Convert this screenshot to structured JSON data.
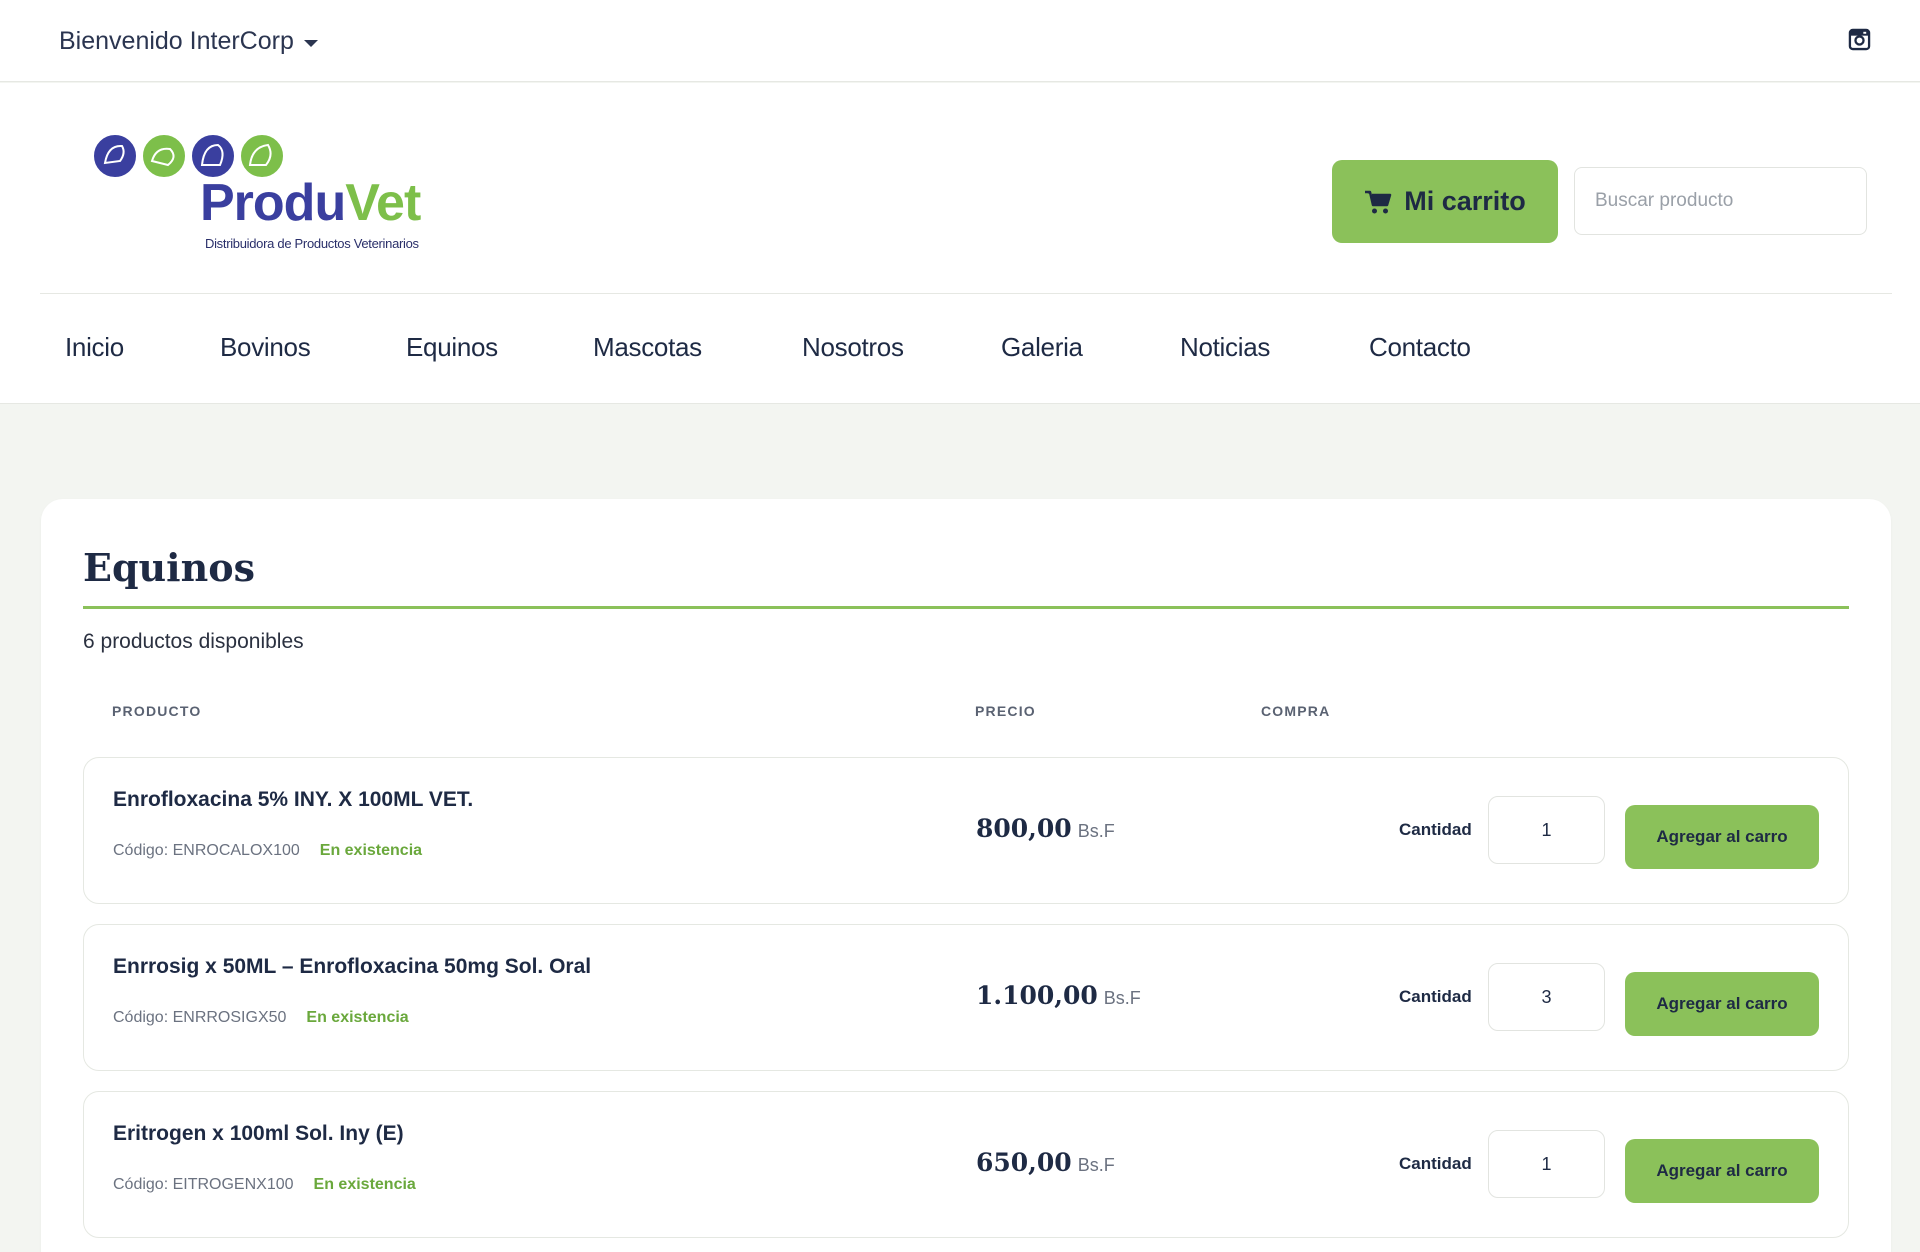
{
  "topbar": {
    "welcome": "Bienvenido InterCorp"
  },
  "header": {
    "logo_main_1": "Produ",
    "logo_main_2": "Vet",
    "logo_sub": "Distribuidora de Productos Veterinarios",
    "cart_label": "Mi carrito",
    "search_placeholder": "Buscar producto"
  },
  "nav": {
    "items": [
      {
        "label": "Inicio"
      },
      {
        "label": "Bovinos"
      },
      {
        "label": "Equinos"
      },
      {
        "label": "Mascotas"
      },
      {
        "label": "Nosotros"
      },
      {
        "label": "Galeria"
      },
      {
        "label": "Noticias"
      },
      {
        "label": "Contacto"
      }
    ]
  },
  "colors": {
    "accent_green": "#8bc15a",
    "navy": "#1e2a44",
    "stock_green": "#6aa83c"
  },
  "main": {
    "title": "Equinos",
    "count": "6 productos disponibles",
    "columns": {
      "product": "PRODUCTO",
      "price": "PRECIO",
      "purchase": "COMPRA"
    },
    "products": [
      {
        "name": "Enrofloxacina 5% INY. X 100ML VET.",
        "code": "Código: ENROCALOX100",
        "stock": "En existencia",
        "price": "800,00",
        "currency": "Bs.F",
        "qty_label": "Cantidad",
        "qty": "1",
        "add_label": "Agregar al carro"
      },
      {
        "name": "Enrrosig x 50ML – Enrofloxacina 50mg Sol. Oral",
        "code": "Código: ENRROSIGX50",
        "stock": "En existencia",
        "price": "1.100,00",
        "currency": "Bs.F",
        "qty_label": "Cantidad",
        "qty": "3",
        "add_label": "Agregar al carro"
      },
      {
        "name": "Eritrogen x 100ml Sol. Iny (E)",
        "code": "Código: EITROGENX100",
        "stock": "En existencia",
        "price": "650,00",
        "currency": "Bs.F",
        "qty_label": "Cantidad",
        "qty": "1",
        "add_label": "Agregar al carro"
      }
    ]
  }
}
